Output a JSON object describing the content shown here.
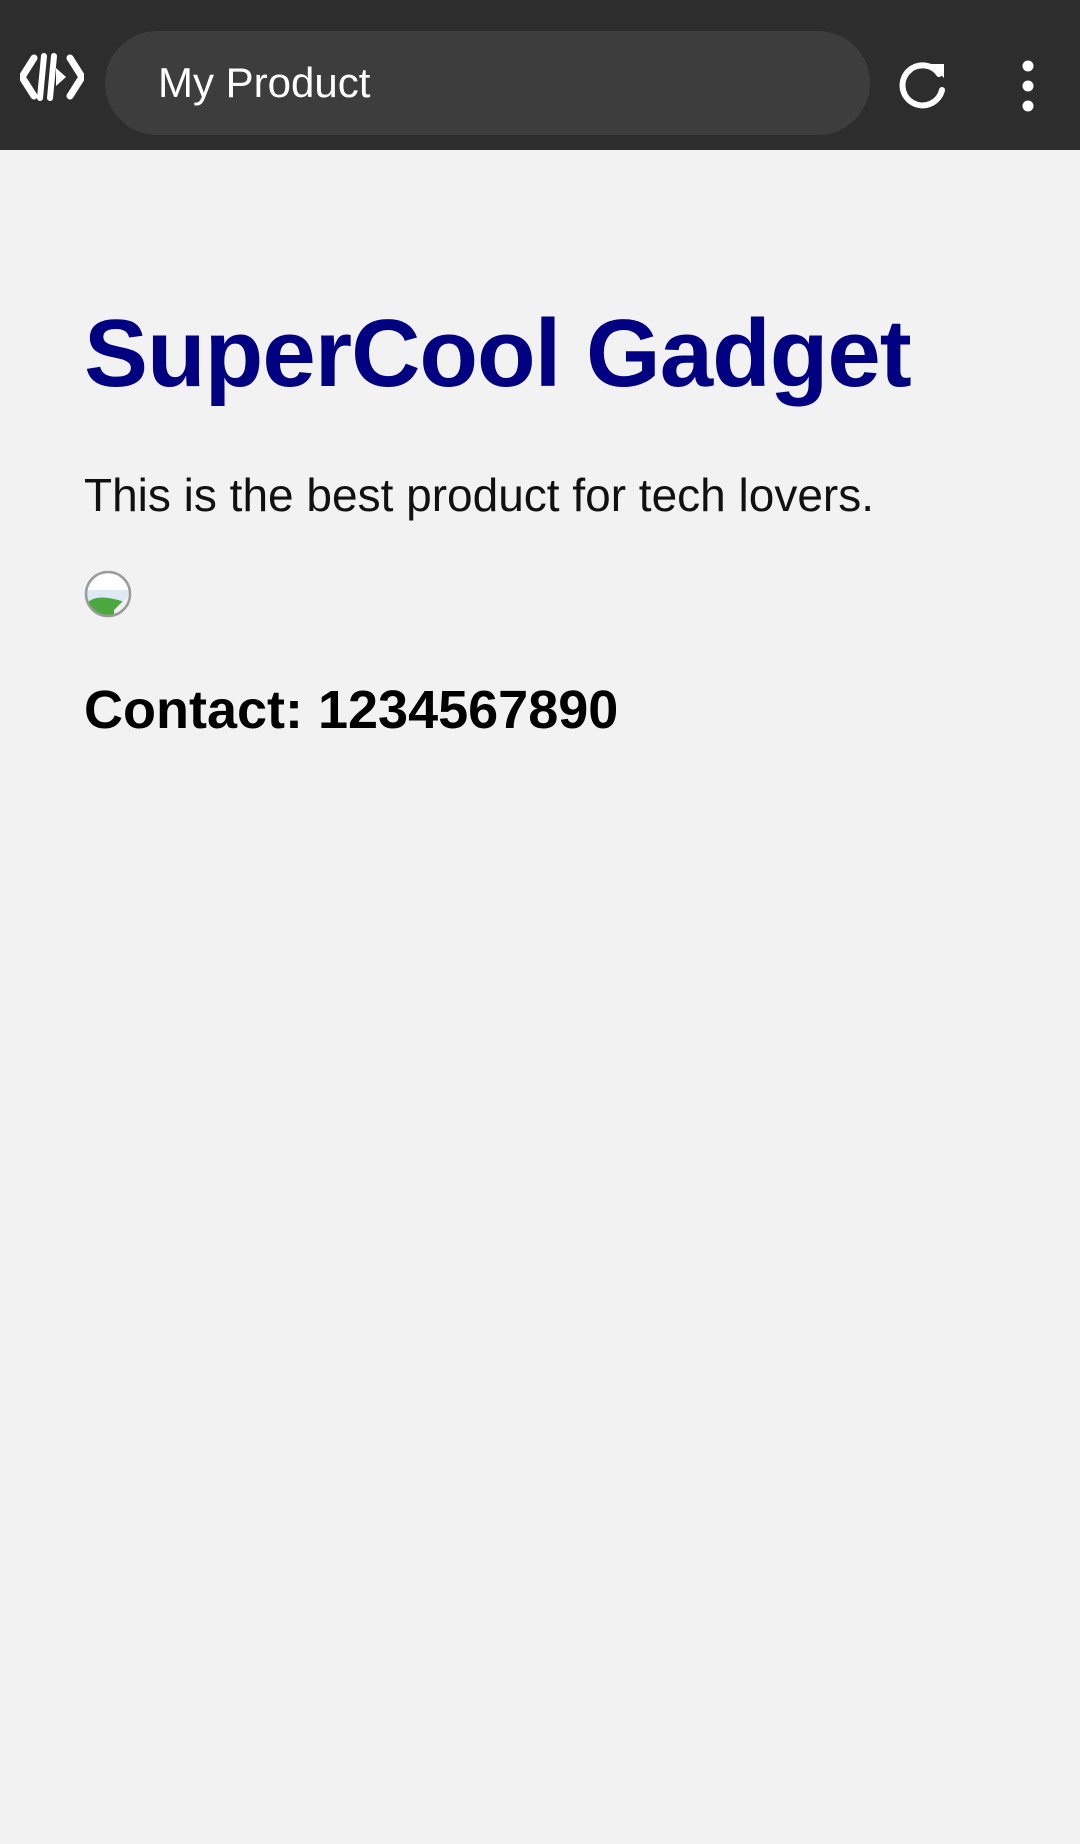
{
  "browser": {
    "url_bar_text": "My Product",
    "icons": {
      "brand": "code-brackets-icon",
      "reload": "reload-icon",
      "menu": "more-vertical-icon"
    },
    "colors": {
      "toolbar": "#2d2d2d",
      "url_bar": "#3d3d3d",
      "text": "#ffffff"
    }
  },
  "page": {
    "title": "SuperCool Gadget",
    "description": "This is the best product for tech lovers.",
    "image_icon": "broken-image-icon",
    "contact": "Contact: 1234567890",
    "colors": {
      "background": "#f2f2f2",
      "title": "#000080",
      "text": "#000000"
    }
  }
}
